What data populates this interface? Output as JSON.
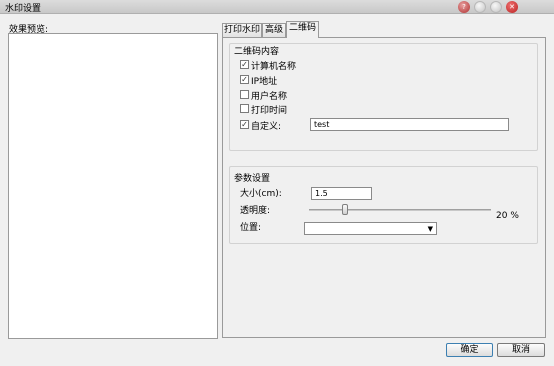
{
  "window": {
    "title": "水印设置",
    "controls": [
      {
        "name": "help-icon",
        "glyph": "?"
      },
      {
        "name": "minimize-icon",
        "glyph": ""
      },
      {
        "name": "maximize-icon",
        "glyph": ""
      },
      {
        "name": "close-icon",
        "glyph": "✕"
      }
    ]
  },
  "preview": {
    "label": "效果预览:"
  },
  "tabs": [
    {
      "label": "打印水印",
      "active": false
    },
    {
      "label": "高级",
      "active": false
    },
    {
      "label": "二维码",
      "active": true
    }
  ],
  "qrcode_content": {
    "title": "二维码内容",
    "options": [
      {
        "label": "计算机名称",
        "checked": true
      },
      {
        "label": "IP地址",
        "checked": true
      },
      {
        "label": "用户名称",
        "checked": false
      },
      {
        "label": "打印时间",
        "checked": false
      },
      {
        "label": "自定义:",
        "checked": true
      }
    ],
    "custom_value": "test"
  },
  "params": {
    "title": "参数设置",
    "size_label": "大小(cm):",
    "size_value": "1.5",
    "opacity_label": "透明度:",
    "opacity_value": "20 %",
    "opacity_fraction": 0.2,
    "position_label": "位置:",
    "position_value": ""
  },
  "buttons": {
    "ok": "确定",
    "cancel": "取消"
  }
}
